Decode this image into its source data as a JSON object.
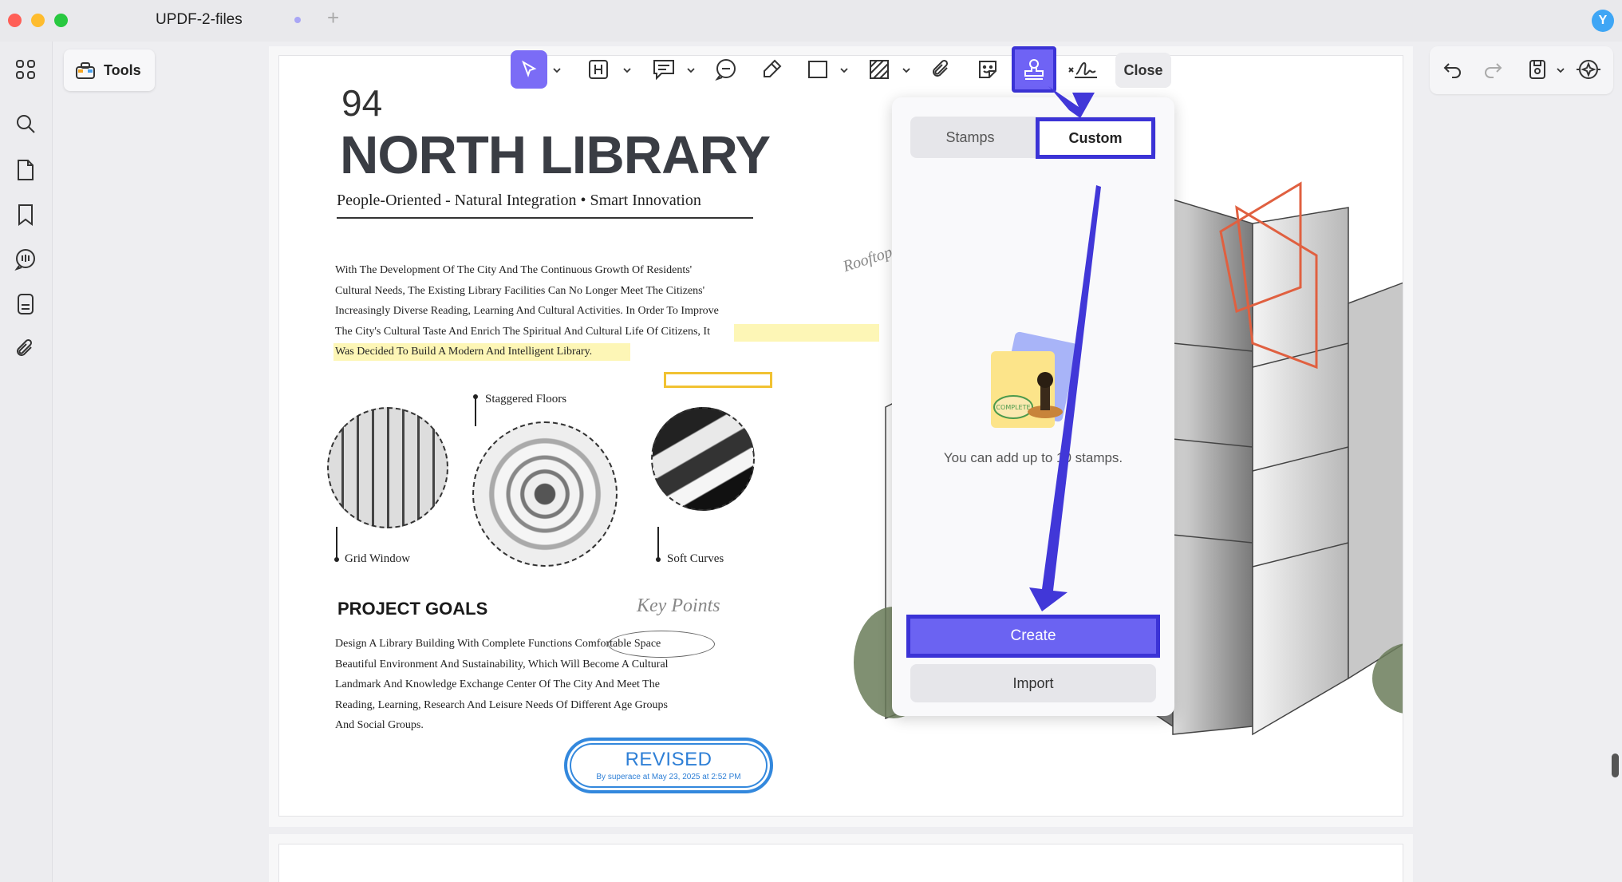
{
  "window": {
    "tab_title": "UPDF-2-files",
    "add_tab": "+",
    "avatar_initial": "Y"
  },
  "left_rail": {
    "icons": [
      "grid-icon",
      "search-icon",
      "page-icon",
      "bookmark-icon",
      "comment-icon",
      "form-icon",
      "attachment-icon"
    ]
  },
  "tools": {
    "label": "Tools"
  },
  "toolbar": {
    "close_label": "Close",
    "icons": [
      "select-icon",
      "text-icon",
      "note-icon",
      "comment-icon",
      "pencil-icon",
      "rectangle-icon",
      "hatch-icon",
      "attachment-icon",
      "sticker-icon",
      "stamp-icon",
      "signature-icon"
    ]
  },
  "right_tools": {
    "icons": [
      "undo-icon",
      "redo-icon",
      "save-icon",
      "ai-icon"
    ]
  },
  "document": {
    "page_number": "94",
    "title": "NORTH LIBRARY",
    "subtitle": "People-Oriented - Natural Integration • Smart Innovation",
    "body_lines": [
      "With The Development Of The City And The Continuous Growth Of Residents'",
      "Cultural Needs, The Existing Library Facilities Can No Longer Meet The Citizens'",
      "Increasingly Diverse Reading, Learning And Cultural Activities. In Order To Improve",
      "The City's Cultural Taste And Enrich The Spiritual And Cultural Life Of Citizens, It",
      "Was Decided To Build A Modern And Intelligent Library."
    ],
    "captions": {
      "staggered": "Staggered Floors",
      "grid": "Grid Window",
      "soft": "Soft Curves",
      "rooftop": "Rooftop"
    },
    "goals_heading": "PROJECT GOALS",
    "key_points": "Key Points",
    "goals_lines": [
      "Design A Library Building With Complete Functions Comfortable Space",
      "Beautiful Environment And Sustainability, Which Will Become A Cultural",
      "Landmark And Knowledge Exchange Center Of The City And Meet The",
      "Reading, Learning, Research And Leisure Needs Of Different Age Groups",
      "And Social Groups."
    ],
    "stamp": {
      "title": "REVISED",
      "subtitle": "By superace at May 23, 2025 at 2:52 PM"
    }
  },
  "stamp_panel": {
    "tab_stamps": "Stamps",
    "tab_custom": "Custom",
    "hint": "You can add up to 10 stamps.",
    "illustration_text": "COMPLETE",
    "create_label": "Create",
    "import_label": "Import"
  },
  "colors": {
    "accent": "#6b63f2",
    "highlight_border": "#3b33d6",
    "stamp_blue": "#2e7fd6"
  }
}
